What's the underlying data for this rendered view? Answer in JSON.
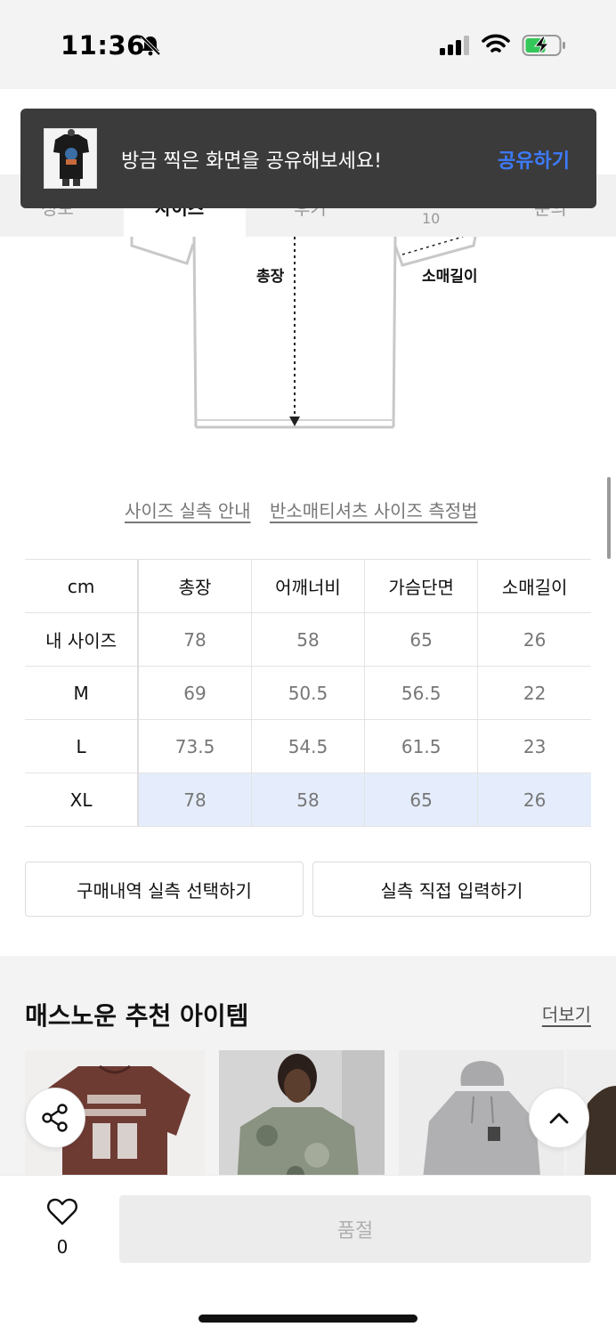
{
  "status_bar": {
    "time": "11:36"
  },
  "tabs": {
    "items": [
      {
        "label": "정보"
      },
      {
        "label": "사이즈"
      },
      {
        "label": "후기"
      },
      {
        "label": "문의"
      }
    ],
    "review_count": "10"
  },
  "toast": {
    "message": "방금 찍은 화면을 공유해보세요!",
    "action": "공유하기",
    "action_color": "#3d7bff"
  },
  "diagram": {
    "total_length_label": "총장",
    "sleeve_length_label": "소매길이"
  },
  "guide_links": {
    "size_guide": "사이즈 실측 안내",
    "measure_method": "반소매티셔츠 사이즈 측정법"
  },
  "size_table": {
    "headers": [
      "cm",
      "총장",
      "어깨너비",
      "가슴단면",
      "소매길이"
    ],
    "rows": [
      {
        "label": "내 사이즈",
        "values": [
          "78",
          "58",
          "65",
          "26"
        ]
      },
      {
        "label": "M",
        "values": [
          "69",
          "50.5",
          "56.5",
          "22"
        ]
      },
      {
        "label": "L",
        "values": [
          "73.5",
          "54.5",
          "61.5",
          "23"
        ]
      },
      {
        "label": "XL",
        "values": [
          "78",
          "58",
          "65",
          "26"
        ],
        "highlighted": true
      }
    ],
    "highlight_color": "#e5edfc"
  },
  "buttons": {
    "purchase_history": "구매내역 실측 선택하기",
    "direct_input": "실측 직접 입력하기"
  },
  "recommend": {
    "title": "매스노운 추천 아이템",
    "more": "더보기"
  },
  "bottom_bar": {
    "like_count": "0",
    "sold_out_label": "품절"
  }
}
